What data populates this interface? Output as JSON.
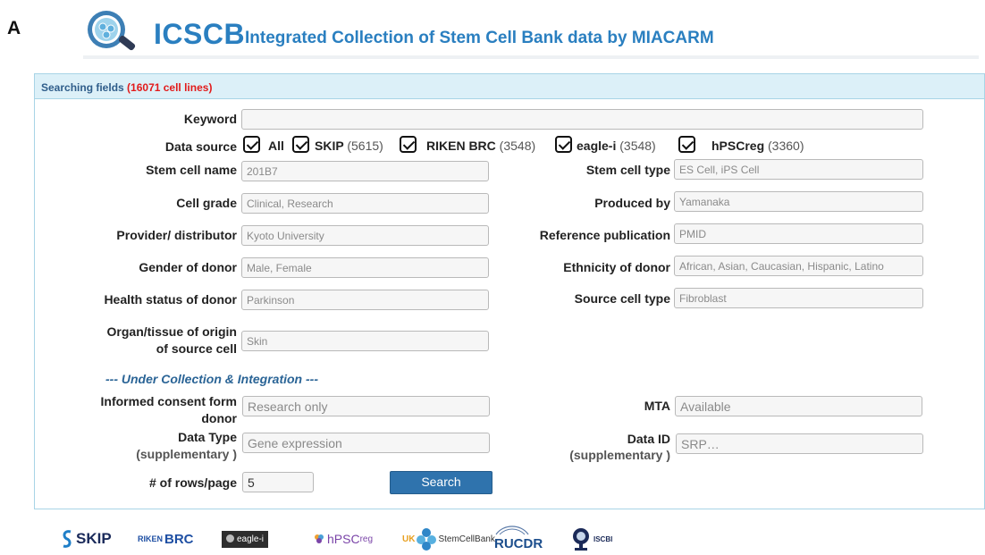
{
  "panel_letter": "A",
  "header": {
    "acronym": "ICSCB",
    "title": "Integrated Collection of Stem Cell Bank data by MIACARM",
    "accent_color": "#2a7fc0"
  },
  "search": {
    "heading": "Searching fields",
    "count_label": "(16071 cell lines)",
    "keyword_label": "Keyword",
    "keyword_value": "",
    "data_source_label": "Data source",
    "sources": [
      {
        "name": "All",
        "count": "",
        "checked": true
      },
      {
        "name": "SKIP",
        "count": "(5615)",
        "checked": true
      },
      {
        "name": "RIKEN BRC",
        "count": "(3548)",
        "checked": true
      },
      {
        "name": "eagle-i",
        "count": "(3548)",
        "checked": true
      },
      {
        "name": "hPSCreg",
        "count": "(3360)",
        "checked": true
      }
    ],
    "fields": {
      "stem_cell_name": {
        "label": "Stem cell name",
        "placeholder": "201B7"
      },
      "stem_cell_type": {
        "label": "Stem cell type",
        "placeholder": "ES Cell, iPS Cell"
      },
      "cell_grade": {
        "label": "Cell grade",
        "placeholder": "Clinical, Research"
      },
      "produced_by": {
        "label": "Produced by",
        "placeholder": "Yamanaka"
      },
      "provider": {
        "label": "Provider/ distributor",
        "placeholder": "Kyoto University"
      },
      "reference": {
        "label": "Reference publication",
        "placeholder": "PMID"
      },
      "gender": {
        "label": "Gender of donor",
        "placeholder": "Male, Female"
      },
      "ethnicity": {
        "label": "Ethnicity of donor",
        "placeholder": "African, Asian, Caucasian, Hispanic, Latino"
      },
      "health": {
        "label": "Health status of donor",
        "placeholder": "Parkinson"
      },
      "source_cell": {
        "label": "Source cell type",
        "placeholder": "Fibroblast"
      },
      "organ": {
        "label_line1": "Organ/tissue of origin",
        "label_line2": "of source cell",
        "placeholder": "Skin"
      }
    },
    "section_note": "--- Under Collection & Integration ---",
    "extra": {
      "consent": {
        "label_line1": "Informed consent form",
        "label_line2": "donor",
        "placeholder": "Research only"
      },
      "mta": {
        "label": "MTA",
        "placeholder": "Available"
      },
      "data_type": {
        "label_line1": "Data Type",
        "label_line2": "(supplementary )",
        "placeholder": "Gene expression"
      },
      "data_id": {
        "label_line1": "Data ID",
        "label_line2": "(supplementary )",
        "placeholder": "SRP…"
      }
    },
    "rows_label": "# of rows/page",
    "rows_value": "5",
    "search_button": "Search",
    "count_color": "#e21b1b"
  },
  "partners": [
    {
      "name": "SKIP",
      "icon": "skip-logo"
    },
    {
      "name": "BRC",
      "prefix": "RIKEN",
      "icon": "riken-brc-logo"
    },
    {
      "name": "eagle-i",
      "icon": "eagle-i-logo"
    },
    {
      "name": "hPSC",
      "sup": "reg",
      "icon": "hpscreg-logo"
    },
    {
      "name": "StemCellBank",
      "prefix": "UK",
      "icon": "uk-stem-cell-bank-logo"
    },
    {
      "name": "RUCDR",
      "icon": "rucdr-logo"
    },
    {
      "name": "ISCBI",
      "icon": "iscbi-logo"
    }
  ]
}
